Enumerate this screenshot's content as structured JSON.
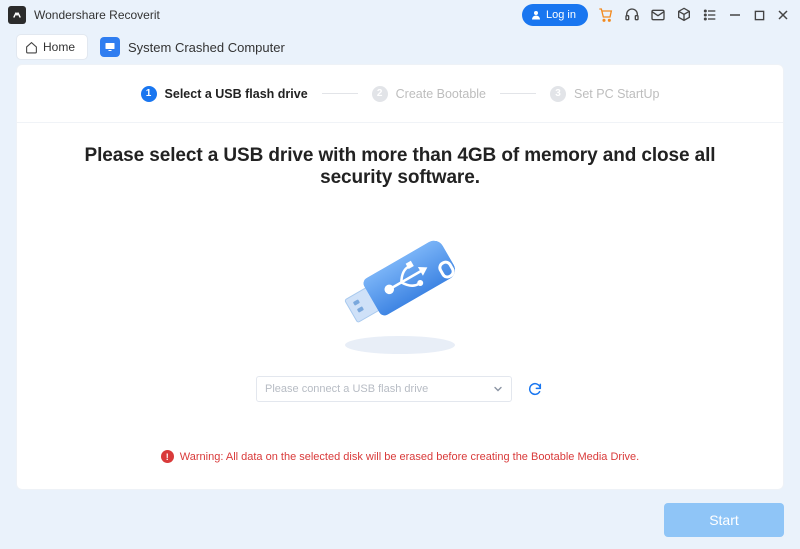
{
  "titlebar": {
    "app_title": "Wondershare Recoverit",
    "login_label": "Log in"
  },
  "crumb": {
    "home_label": "Home",
    "page_label": "System Crashed Computer"
  },
  "stepper": {
    "step1": {
      "num": "1",
      "label": "Select a USB flash drive"
    },
    "step2": {
      "num": "2",
      "label": "Create Bootable"
    },
    "step3": {
      "num": "3",
      "label": "Set PC StartUp"
    }
  },
  "main": {
    "headline": "Please select a USB drive with more than 4GB of memory and close all security software.",
    "select_placeholder": "Please connect a USB flash drive",
    "warning_text": "Warning: All data on the selected disk will be erased before creating the Bootable Media Drive."
  },
  "footer": {
    "start_label": "Start"
  }
}
